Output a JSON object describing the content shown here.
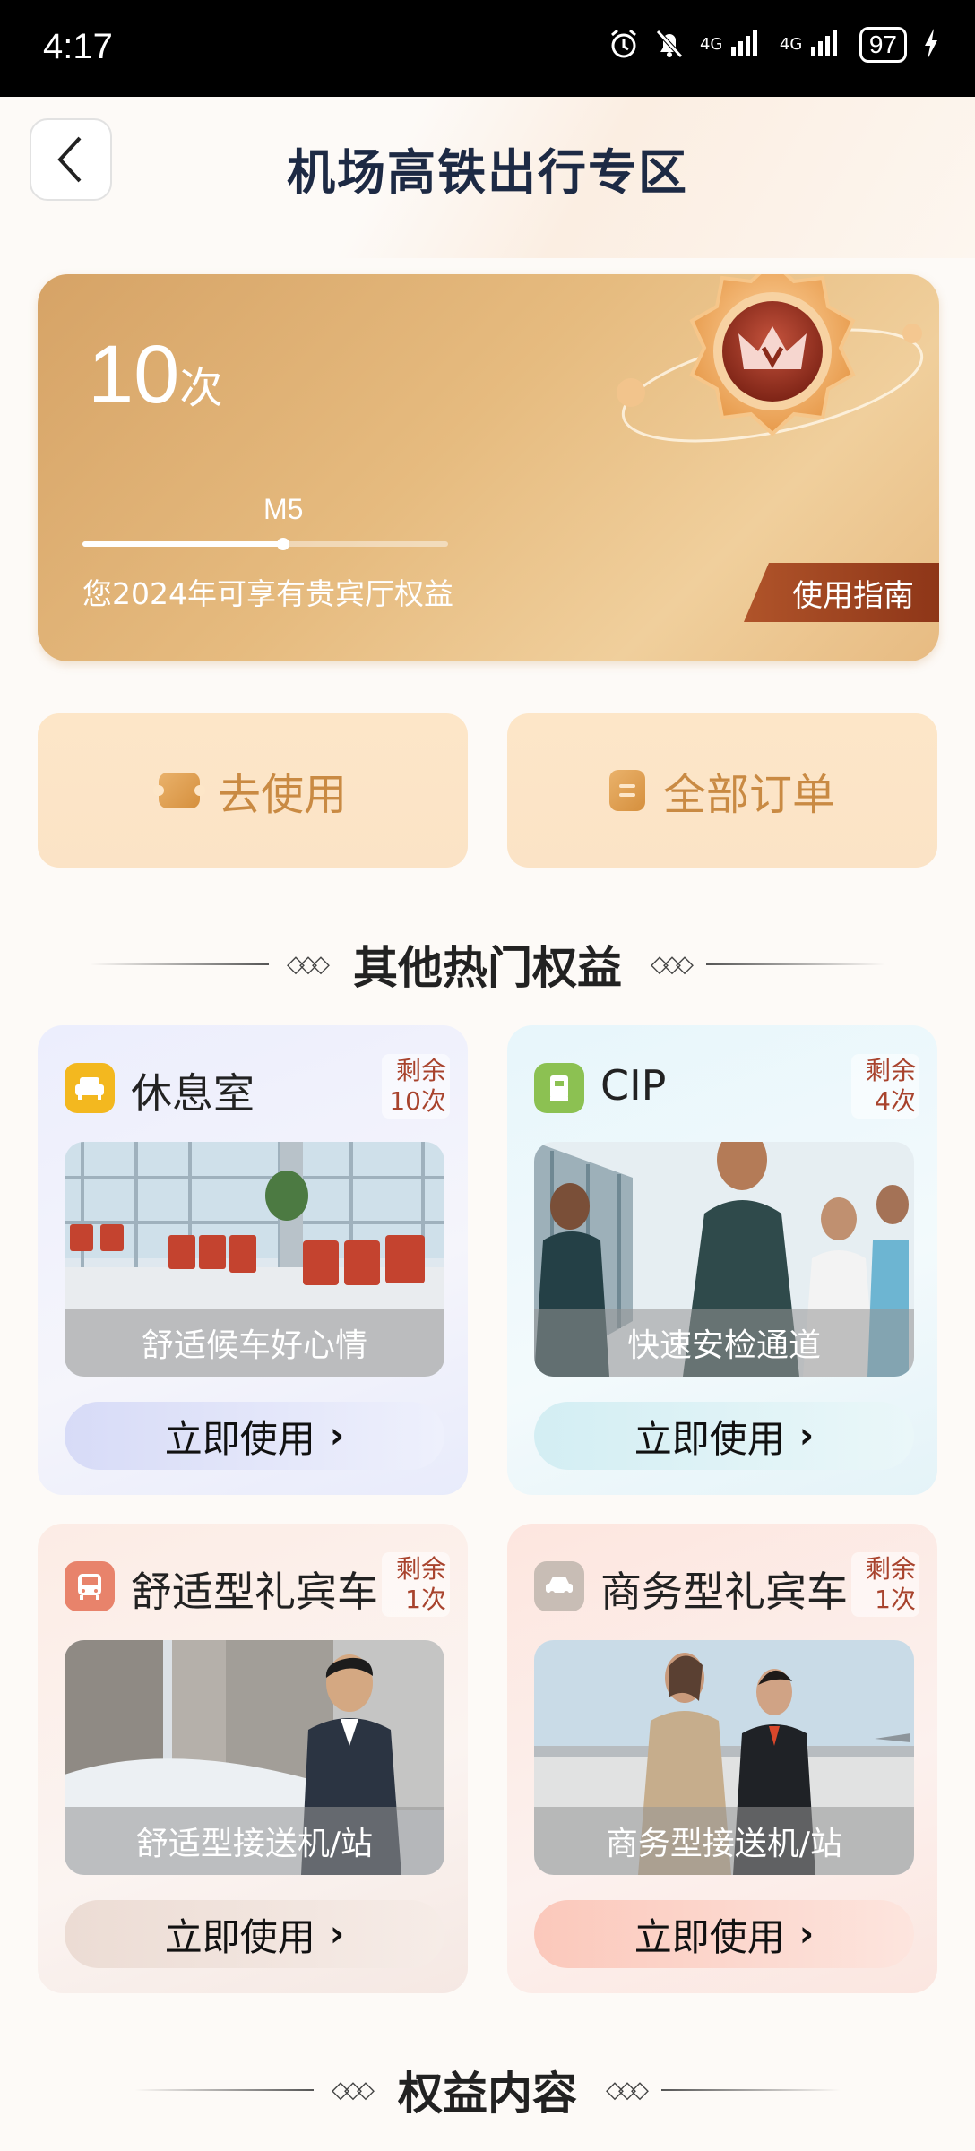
{
  "status_bar": {
    "time": "4:17",
    "signal_1": "4G",
    "signal_2": "4G",
    "battery": "97"
  },
  "header": {
    "title": "机场高铁出行专区"
  },
  "member_card": {
    "count": "10",
    "count_unit": "次",
    "level": "M5",
    "progress_fraction": 0.55,
    "description": "您2024年可享有贵宾厅权益",
    "guide_label": "使用指南",
    "badge_icon": "crown-v-badge"
  },
  "actions": [
    {
      "label": "去使用",
      "icon": "ticket-icon"
    },
    {
      "label": "全部订单",
      "icon": "order-list-icon"
    }
  ],
  "sections": {
    "popular": "其他热门权益",
    "content": "权益内容"
  },
  "benefits": [
    {
      "name": "休息室",
      "remain_label": "剩余",
      "remain_count": "10次",
      "caption": "舒适候车好心情",
      "button": "立即使用",
      "icon": "sofa-icon",
      "icon_color": "#f3b81f"
    },
    {
      "name": "CIP",
      "remain_label": "剩余",
      "remain_count": "4次",
      "caption": "快速安检通道",
      "button": "立即使用",
      "icon": "gate-icon",
      "icon_color": "#8cc152"
    },
    {
      "name": "舒适型礼宾车",
      "remain_label": "剩余",
      "remain_count": "1次",
      "caption": "舒适型接送机/站",
      "button": "立即使用",
      "icon": "bus-icon",
      "icon_color": "#e8836b"
    },
    {
      "name": "商务型礼宾车",
      "remain_label": "剩余",
      "remain_count": "1次",
      "caption": "商务型接送机/站",
      "button": "立即使用",
      "icon": "car-icon",
      "icon_color": "#c8bdb5"
    }
  ]
}
